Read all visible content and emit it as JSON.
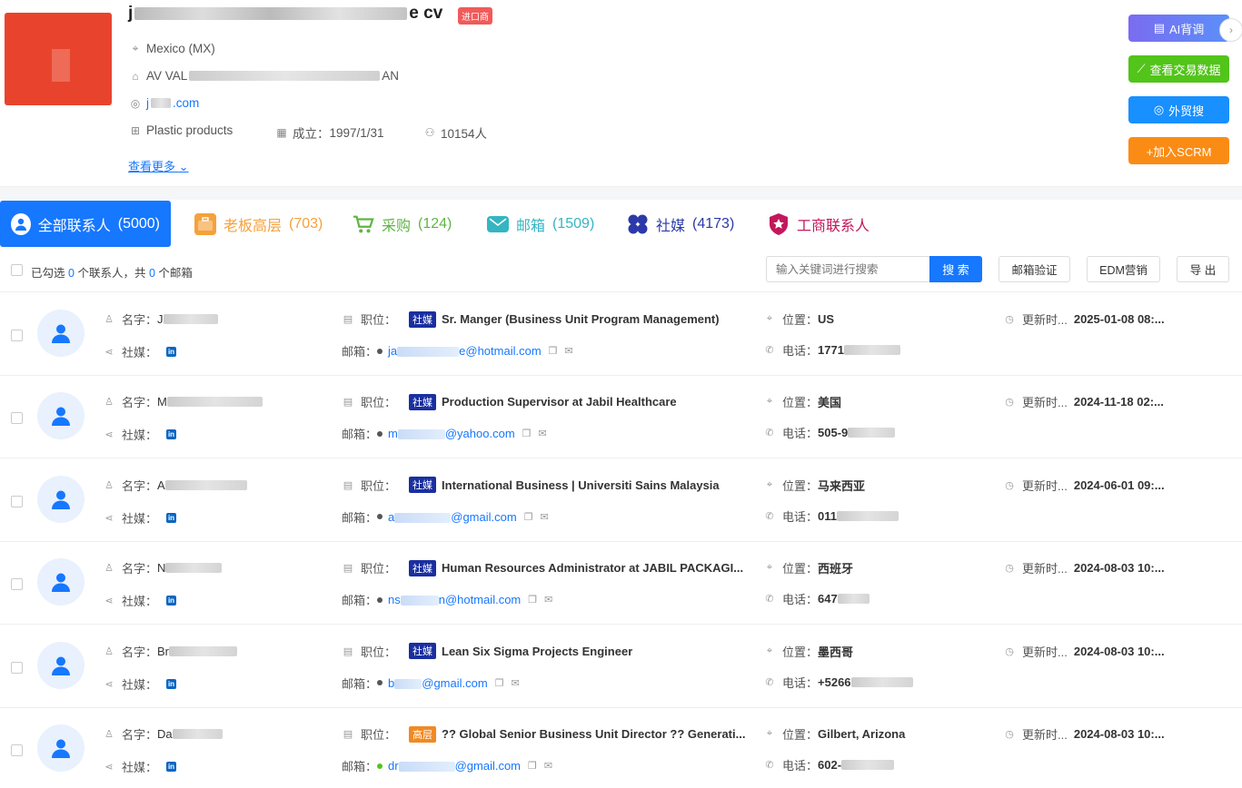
{
  "company": {
    "name_prefix": "j",
    "name_suffix": "e cv",
    "import_badge": "进口商",
    "location": "Mexico (MX)",
    "address_prefix": "AV VAL",
    "address_suffix": "AN",
    "website_prefix": "j",
    "website_suffix": ".com",
    "industry": "Plastic products",
    "founded_label": "成立：",
    "founded": "1997/1/31",
    "employees": "10154人",
    "more_label": "查看更多"
  },
  "side_buttons": {
    "ai": "AI背调",
    "trade": "查看交易数据",
    "waimao": "外贸搜",
    "scrm": "+加入SCRM"
  },
  "tabs": [
    {
      "label": "全部联系人",
      "count": "(5000)",
      "color": "#ffffff"
    },
    {
      "label": "老板高层",
      "count": "(703)",
      "color": "#f5a13c"
    },
    {
      "label": "采购",
      "count": "(124)",
      "color": "#5fb544"
    },
    {
      "label": "邮箱",
      "count": "(1509)",
      "color": "#35b5c2"
    },
    {
      "label": "社媒",
      "count": "(4173)",
      "color": "#2b3aa8"
    },
    {
      "label": "工商联系人",
      "count": "",
      "color": "#c2185b"
    }
  ],
  "toolbar": {
    "sel_a": "已勾选",
    "sel_count": "0",
    "sel_b": "个联系人，共",
    "email_count": "0",
    "sel_c": "个邮箱",
    "search_placeholder": "输入关键词进行搜索",
    "search_btn": "搜 索",
    "verify_btn": "邮箱验证",
    "edm_btn": "EDM营销",
    "export_btn": "导 出"
  },
  "labels": {
    "name": "名字：",
    "social": "社媒：",
    "position": "职位：",
    "email": "邮箱：",
    "location": "位置：",
    "phone": "电话：",
    "updated": "更新时...",
    "linkedin": "in"
  },
  "contacts": [
    {
      "name": "J",
      "tag": "社媒",
      "tag_type": "social",
      "title": "Sr. Manger (Business Unit Program Management)",
      "email_prefix": "ja",
      "email_domain": "e@hotmail.com",
      "dot": "#555555",
      "location": "US",
      "phone": "1771",
      "updated": "2025-01-08 08:..."
    },
    {
      "name": "M",
      "tag": "社媒",
      "tag_type": "social",
      "title": "Production Supervisor at Jabil Healthcare",
      "email_prefix": "m",
      "email_domain": "@yahoo.com",
      "dot": "#555555",
      "location": "美国",
      "phone": "505-9",
      "updated": "2024-11-18 02:..."
    },
    {
      "name": "A",
      "tag": "社媒",
      "tag_type": "social",
      "title": "International Business | Universiti Sains Malaysia",
      "email_prefix": "a",
      "email_domain": "@gmail.com",
      "dot": "#555555",
      "location": "马来西亚",
      "phone": "011",
      "updated": "2024-06-01 09:..."
    },
    {
      "name": "N",
      "tag": "社媒",
      "tag_type": "social",
      "title": "Human Resources Administrator at JABIL PACKAGI...",
      "email_prefix": "ns",
      "email_domain": "n@hotmail.com",
      "dot": "#555555",
      "location": "西班牙",
      "phone": "647",
      "updated": "2024-08-03 10:..."
    },
    {
      "name": "Br",
      "tag": "社媒",
      "tag_type": "social",
      "title": "Lean Six Sigma Projects Engineer",
      "email_prefix": "b",
      "email_domain": "@gmail.com",
      "dot": "#555555",
      "location": "墨西哥",
      "phone": "+5266",
      "updated": "2024-08-03 10:..."
    },
    {
      "name": "Da",
      "tag": "高层",
      "tag_type": "senior",
      "title": "?? Global Senior Business Unit Director ?? Generati...",
      "email_prefix": "dr",
      "email_domain": "@gmail.com",
      "dot": "#52c41a",
      "location": "Gilbert, Arizona",
      "phone": "602-",
      "updated": "2024-08-03 10:..."
    }
  ]
}
